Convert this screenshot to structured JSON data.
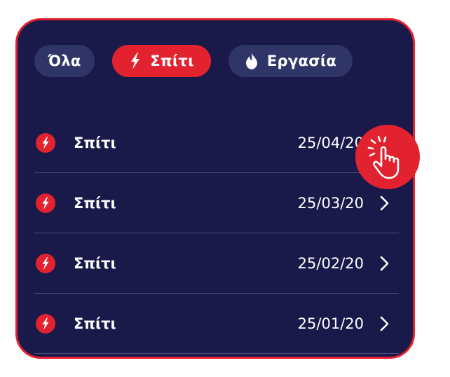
{
  "colors": {
    "panel": "#19194a",
    "accent": "#e3222f",
    "chip": "#2f3566",
    "divider": "#4a4f7c"
  },
  "filters": [
    {
      "label": "Όλα",
      "icon": ""
    },
    {
      "label": "Σπίτι",
      "icon": "lightning-icon"
    },
    {
      "label": "Εργασία",
      "icon": "flame-icon"
    }
  ],
  "rows": [
    {
      "label": "Σπίτι",
      "date": "25/04/20",
      "icon": "lightning-icon"
    },
    {
      "label": "Σπίτι",
      "date": "25/03/20",
      "icon": "lightning-icon"
    },
    {
      "label": "Σπίτι",
      "date": "25/02/20",
      "icon": "lightning-icon"
    },
    {
      "label": "Σπίτι",
      "date": "25/01/20",
      "icon": "lightning-icon"
    }
  ],
  "overlay": {
    "icon": "tap-hand-icon"
  }
}
